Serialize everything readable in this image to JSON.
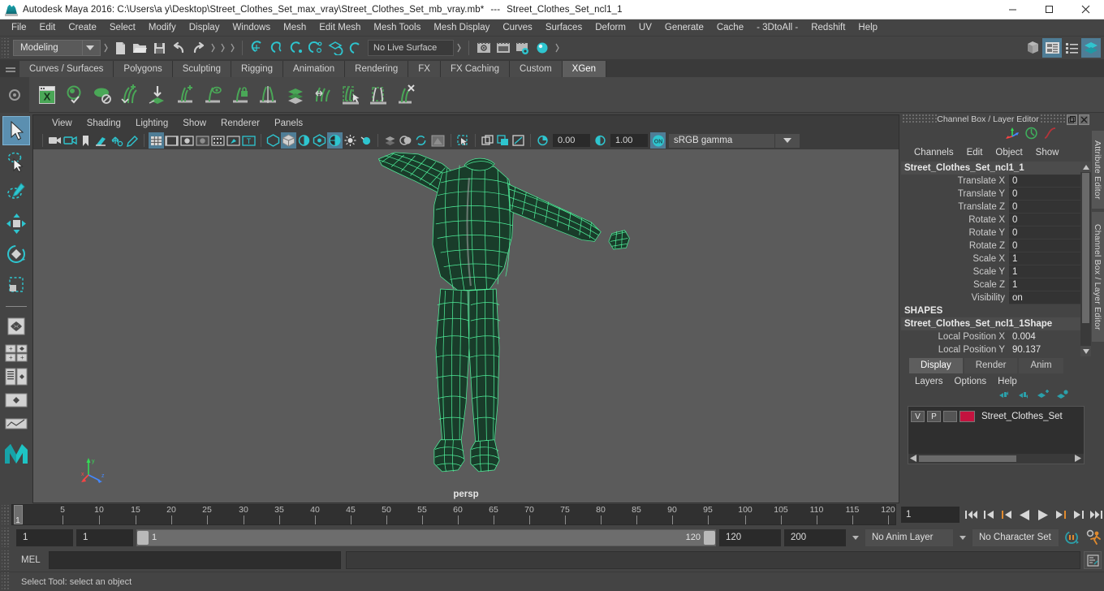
{
  "window": {
    "app_icon": "maya-logo-icon",
    "title": "Autodesk Maya 2016: C:\\Users\\a y\\Desktop\\Street_Clothes_Set_max_vray\\Street_Clothes_Set_mb_vray.mb*",
    "separator": "---",
    "subtitle": "Street_Clothes_Set_ncl1_1",
    "buttons": {
      "minimize": "minimize-button",
      "maximize": "maximize-button",
      "close": "close-button"
    }
  },
  "menubar": {
    "items": [
      "File",
      "Edit",
      "Create",
      "Select",
      "Modify",
      "Display",
      "Windows",
      "Mesh",
      "Edit Mesh",
      "Mesh Tools",
      "Mesh Display",
      "Curves",
      "Surfaces",
      "Deform",
      "UV",
      "Generate",
      "Cache",
      "- 3DtoAll -",
      "Redshift",
      "Help"
    ]
  },
  "statusline": {
    "mode": "Modeling",
    "live_surface": "No Live Surface"
  },
  "shelf": {
    "tabs": [
      "Curves / Surfaces",
      "Polygons",
      "Sculpting",
      "Rigging",
      "Animation",
      "Rendering",
      "FX",
      "FX Caching",
      "Custom",
      "XGen"
    ],
    "active_tab": "XGen",
    "icons": [
      "xgen-editor-icon",
      "preview-refresh-icon",
      "disable-preview-icon",
      "add-description-icon",
      "import-collection-icon",
      "add-guide-icon",
      "guide-visibility-icon",
      "lock-guide-icon",
      "mirror-guide-icon",
      "density-mask-icon",
      "groom-brush-icon",
      "select-region-icon",
      "region-mask-icon",
      "delete-guide-icon"
    ]
  },
  "toolbox": {
    "tools": [
      "select-tool",
      "lasso-select-tool",
      "paint-select-tool",
      "move-tool",
      "rotate-tool",
      "scale-tool"
    ],
    "selected": "select-tool",
    "layouts": [
      "single-perspective-view-icon",
      "four-view-icon",
      "outliner-persp-icon",
      "hypergraph-persp-icon",
      "persp-graph-icon"
    ],
    "logo": "maya-m-logo-icon"
  },
  "viewport": {
    "menus": [
      "View",
      "Shading",
      "Lighting",
      "Show",
      "Renderer",
      "Panels"
    ],
    "toolbar": {
      "exposure_value": "0.00",
      "gamma_value": "1.00",
      "color_management": "sRGB gamma",
      "cm_toggle": "ON"
    },
    "camera_label": "persp",
    "axis": {
      "x": "x",
      "y": "y",
      "z": "z"
    },
    "mesh_color": "#4ff39c",
    "background_color": "#5b5b5b"
  },
  "channel_box": {
    "panel_title": "Channel Box / Layer Editor",
    "menus": [
      "Channels",
      "Edit",
      "Object",
      "Show"
    ],
    "node_name": "Street_Clothes_Set_ncl1_1",
    "attributes": [
      {
        "label": "Translate X",
        "value": "0"
      },
      {
        "label": "Translate Y",
        "value": "0"
      },
      {
        "label": "Translate Z",
        "value": "0"
      },
      {
        "label": "Rotate X",
        "value": "0"
      },
      {
        "label": "Rotate Y",
        "value": "0"
      },
      {
        "label": "Rotate Z",
        "value": "0"
      },
      {
        "label": "Scale X",
        "value": "1"
      },
      {
        "label": "Scale Y",
        "value": "1"
      },
      {
        "label": "Scale Z",
        "value": "1"
      },
      {
        "label": "Visibility",
        "value": "on"
      }
    ],
    "shapes_header": "SHAPES",
    "shape_name": "Street_Clothes_Set_ncl1_1Shape",
    "shape_attributes": [
      {
        "label": "Local Position X",
        "value": "0.004"
      },
      {
        "label": "Local Position Y",
        "value": "90.137"
      }
    ]
  },
  "layer_editor": {
    "tabs": [
      "Display",
      "Render",
      "Anim"
    ],
    "active_tab": "Display",
    "menus": [
      "Layers",
      "Options",
      "Help"
    ],
    "toolbar_icons": [
      "move-layer-up-icon",
      "move-layer-down-icon",
      "new-layer-icon",
      "new-layer-from-selected-icon"
    ],
    "layers": [
      {
        "visible": "V",
        "playback": "P",
        "shading": "",
        "color": "#c4133f",
        "name": "Street_Clothes_Set"
      }
    ]
  },
  "side_tabs": [
    "Attribute Editor",
    "Channel Box / Layer Editor"
  ],
  "timeline": {
    "ticks": [
      5,
      10,
      15,
      20,
      25,
      30,
      35,
      40,
      45,
      50,
      55,
      60,
      65,
      70,
      75,
      80,
      85,
      90,
      95,
      100,
      105,
      110,
      115,
      120
    ],
    "current_frame": "1",
    "current_frame_field": "1",
    "playback_icons": [
      "go-to-start-icon",
      "step-back-keyframe-icon",
      "step-back-frame-icon",
      "play-backwards-icon",
      "play-forwards-icon",
      "step-forward-frame-icon",
      "step-forward-keyframe-icon",
      "go-to-end-icon"
    ]
  },
  "range": {
    "anim_start": "1",
    "playback_start": "1",
    "slider_start_label": "1",
    "slider_end_label": "120",
    "playback_end": "120",
    "anim_end": "200",
    "anim_layer": "No Anim Layer",
    "character_set": "No Character Set",
    "icons": [
      "auto-keyframe-icon",
      "animation-preferences-icon"
    ]
  },
  "command_line": {
    "label": "MEL",
    "input_value": "",
    "output_value": "",
    "script_editor_icon": "script-editor-icon"
  },
  "status": {
    "help_text": "Select Tool: select an object"
  },
  "colors": {
    "accent_blue": "#4f7d96",
    "teal": "#1ba6b0",
    "orange": "#e08a2e",
    "mesh_green": "#4ff39c",
    "layer_red": "#c4133f"
  }
}
